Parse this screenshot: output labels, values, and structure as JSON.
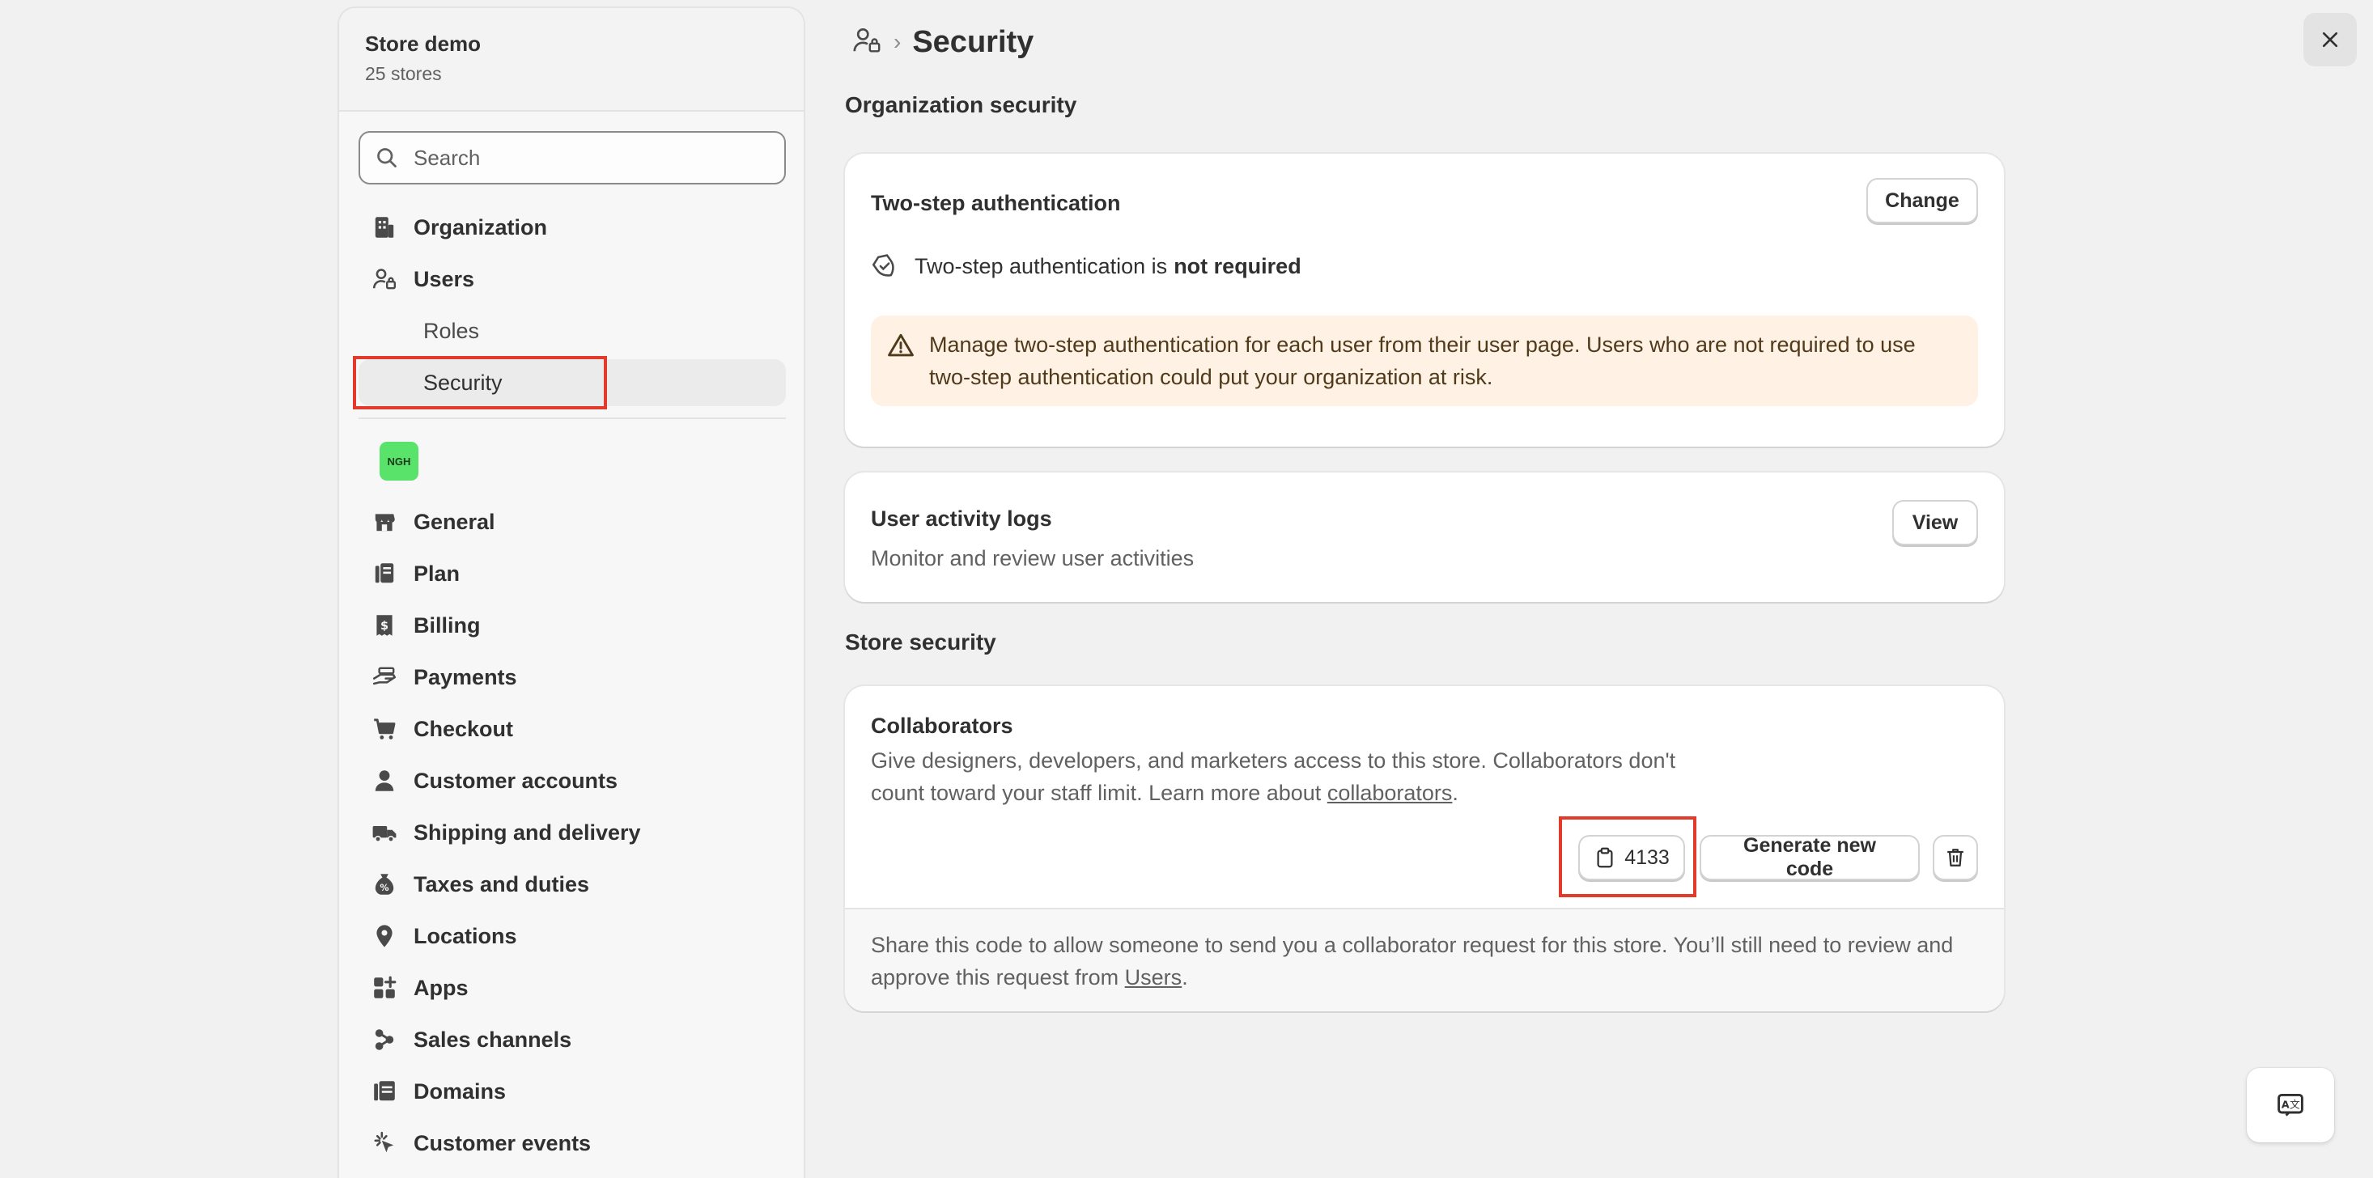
{
  "store": {
    "name": "Store demo",
    "count": "25 stores"
  },
  "search": {
    "placeholder": "Search"
  },
  "nav": {
    "organization": "Organization",
    "users": "Users",
    "roles": "Roles",
    "security": "Security"
  },
  "store_badge": "NGH",
  "store_nav": [
    "General",
    "Plan",
    "Billing",
    "Payments",
    "Checkout",
    "Customer accounts",
    "Shipping and delivery",
    "Taxes and duties",
    "Locations",
    "Apps",
    "Sales channels",
    "Domains",
    "Customer events"
  ],
  "breadcrumb": {
    "title": "Security"
  },
  "org_security": {
    "heading": "Organization security",
    "two_step": {
      "title": "Two-step authentication",
      "change_label": "Change",
      "status_prefix": "Two-step authentication is",
      "status_value": "not required",
      "warning": "Manage two-step authentication for each user from their user page. Users who are not required to use two-step authentication could put your organization at risk."
    },
    "activity_logs": {
      "title": "User activity logs",
      "description": "Monitor and review user activities",
      "view_label": "View"
    }
  },
  "store_security": {
    "heading": "Store security",
    "collaborators": {
      "title": "Collaborators",
      "description": "Give designers, developers, and marketers access to this store. Collaborators don't count toward your staff limit. Learn more about",
      "link": "collaborators",
      "code": "4133",
      "generate_label": "Generate new code",
      "footer_text": "Share this code to allow someone to send you a collaborator request for this store. You’ll still need to review and approve this request from",
      "footer_link": "Users"
    }
  },
  "colors": {
    "highlight": "#e23b2c",
    "store_badge": "#5ae36b",
    "warning_bg": "#fff1e3"
  }
}
